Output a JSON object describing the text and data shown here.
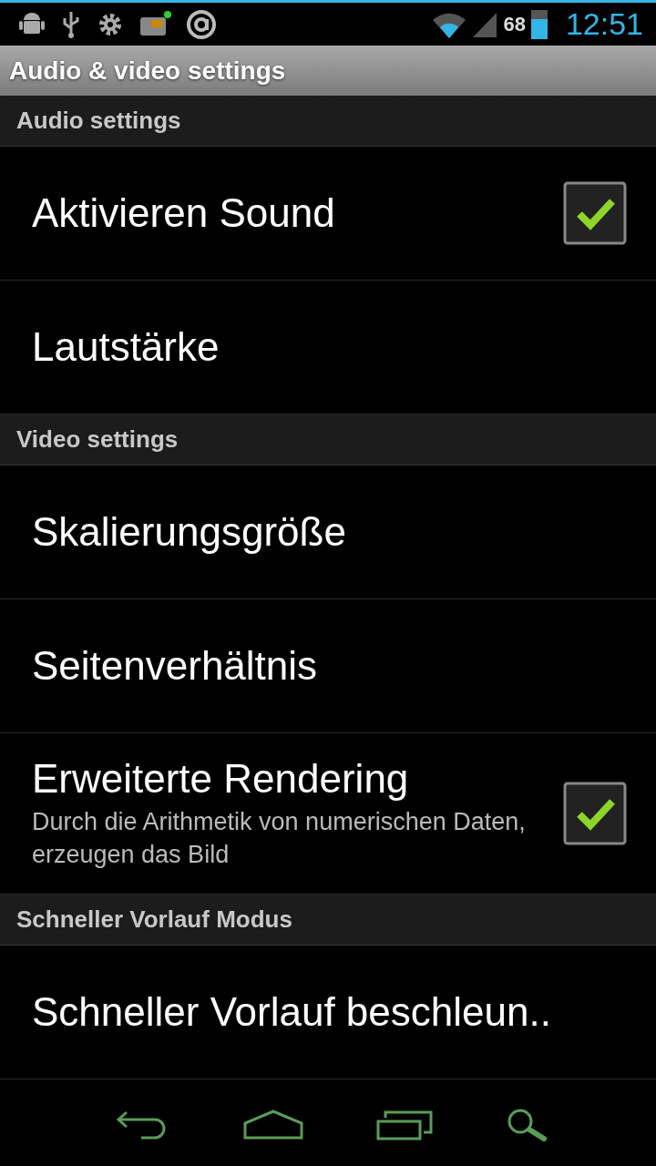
{
  "status_bar": {
    "battery": "68",
    "time": "12:51"
  },
  "window": {
    "title": "Audio & video settings"
  },
  "sections": [
    {
      "header": "Audio settings",
      "items": [
        {
          "kind": "checkbox",
          "title": "Aktivieren Sound",
          "checked": true
        },
        {
          "kind": "plain",
          "title": "Lautstärke"
        }
      ]
    },
    {
      "header": "Video settings",
      "items": [
        {
          "kind": "plain",
          "title": "Skalierungsgröße"
        },
        {
          "kind": "plain",
          "title": "Seitenverhältnis"
        },
        {
          "kind": "checkbox",
          "title": "Erweiterte Rendering",
          "summary": "Durch die Arithmetik von numerischen Daten, erzeugen das Bild",
          "checked": true
        }
      ]
    },
    {
      "header": "Schneller Vorlauf Modus",
      "items": [
        {
          "kind": "plain",
          "title": "Schneller Vorlauf beschleun.."
        }
      ]
    }
  ]
}
